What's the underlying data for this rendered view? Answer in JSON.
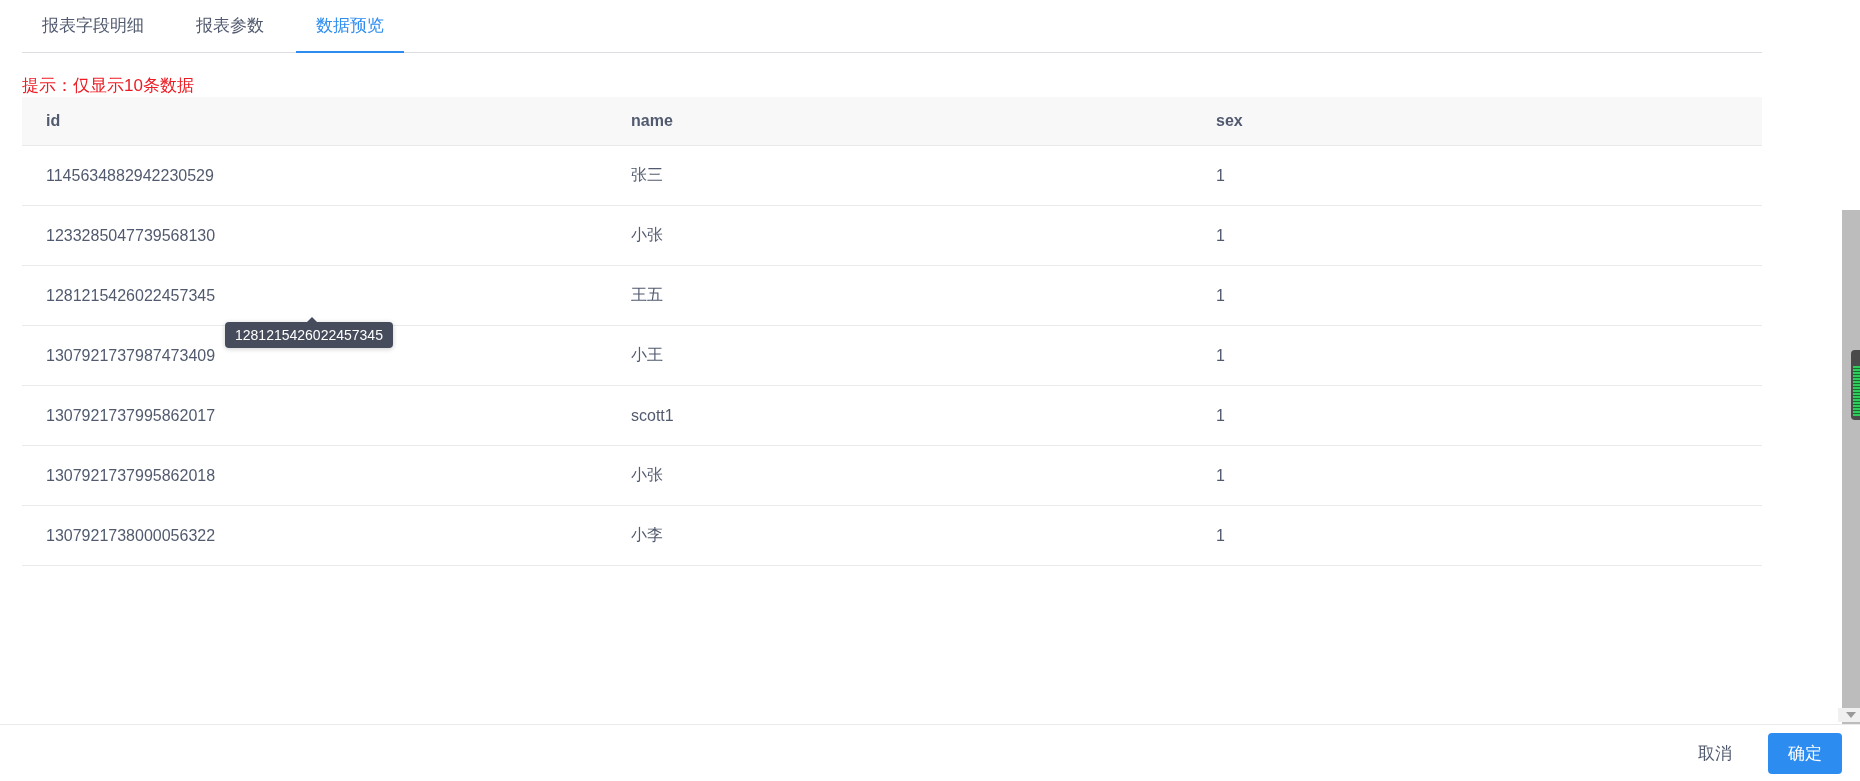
{
  "tabs": [
    {
      "label": "报表字段明细",
      "selected": false
    },
    {
      "label": "报表参数",
      "selected": false
    },
    {
      "label": "数据预览",
      "selected": true
    }
  ],
  "hint": "提示：仅显示10条数据",
  "table": {
    "columns": [
      "id",
      "name",
      "sex"
    ],
    "rows": [
      {
        "cells": [
          "1145634882942230529",
          "张三",
          "1"
        ]
      },
      {
        "cells": [
          "1233285047739568130",
          "小张",
          "1"
        ]
      },
      {
        "cells": [
          "1281215426022457345",
          "王五",
          "1"
        ],
        "tooltip": "1281215426022457345"
      },
      {
        "cells": [
          "1307921737987473409",
          "小王",
          "1"
        ]
      },
      {
        "cells": [
          "1307921737995862017",
          "scott1",
          "1"
        ]
      },
      {
        "cells": [
          "1307921737995862018",
          "小张",
          "1"
        ]
      },
      {
        "cells": [
          "1307921738000056322",
          "小李",
          "1"
        ]
      }
    ]
  },
  "buttons": [
    {
      "label": "取消",
      "kind": "secondary"
    },
    {
      "label": "确定",
      "kind": "primary"
    }
  ]
}
